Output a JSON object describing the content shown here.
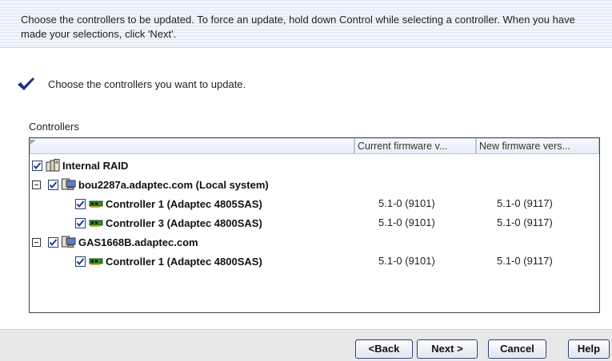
{
  "banner": {
    "text": "Choose the controllers to be updated.  To force an update, hold down Control while selecting a controller.  When you have made your selections, click 'Next'."
  },
  "instruction": {
    "icon": "checkmark-icon",
    "text": "Choose the controllers you want to update."
  },
  "controllers": {
    "label": "Controllers",
    "columns": {
      "current": "Current firmware v...",
      "new": "New firmware vers..."
    },
    "rows": [
      {
        "label": "Internal RAID",
        "icon": "raid-icon",
        "checked": true,
        "current": "",
        "new": ""
      },
      {
        "label": "bou2287a.adaptec.com (Local system)",
        "icon": "computer-icon",
        "checked": true,
        "expanded": true,
        "current": "",
        "new": ""
      },
      {
        "label": "Controller 1 (Adaptec 4805SAS)",
        "icon": "controller-card-icon",
        "checked": true,
        "current": "5.1-0 (9101)",
        "new": "5.1-0 (9117)"
      },
      {
        "label": "Controller 3 (Adaptec 4800SAS)",
        "icon": "controller-card-icon",
        "checked": true,
        "current": "5.1-0 (9101)",
        "new": "5.1-0 (9117)"
      },
      {
        "label": "GAS1668B.adaptec.com",
        "icon": "computer-icon",
        "checked": true,
        "expanded": true,
        "current": "",
        "new": ""
      },
      {
        "label": "Controller 1 (Adaptec 4800SAS)",
        "icon": "controller-card-icon",
        "checked": true,
        "current": "5.1-0 (9101)",
        "new": "5.1-0 (9117)"
      }
    ]
  },
  "buttons": {
    "back": "<Back",
    "next": "Next >",
    "cancel": "Cancel",
    "help": "Help"
  },
  "colors": {
    "accent": "#1f3a8a",
    "banner_bg": "#e9eef9",
    "footer_bg": "#e8e8e8"
  }
}
